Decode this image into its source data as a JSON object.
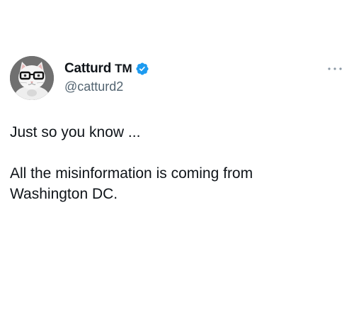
{
  "author": {
    "display_name": "Catturd",
    "tm": "TM",
    "handle": "@catturd2",
    "verified": true,
    "avatar_icon": "cat-with-glasses-avatar"
  },
  "menu": {
    "icon": "more-horizontal-icon"
  },
  "tweet": {
    "line1": "Just so you know ...",
    "line2": "All the misinformation is coming from",
    "line3": "Washington DC."
  },
  "colors": {
    "verified_blue": "#1d9bf0",
    "handle_gray": "#536471",
    "text": "#0f1419"
  }
}
